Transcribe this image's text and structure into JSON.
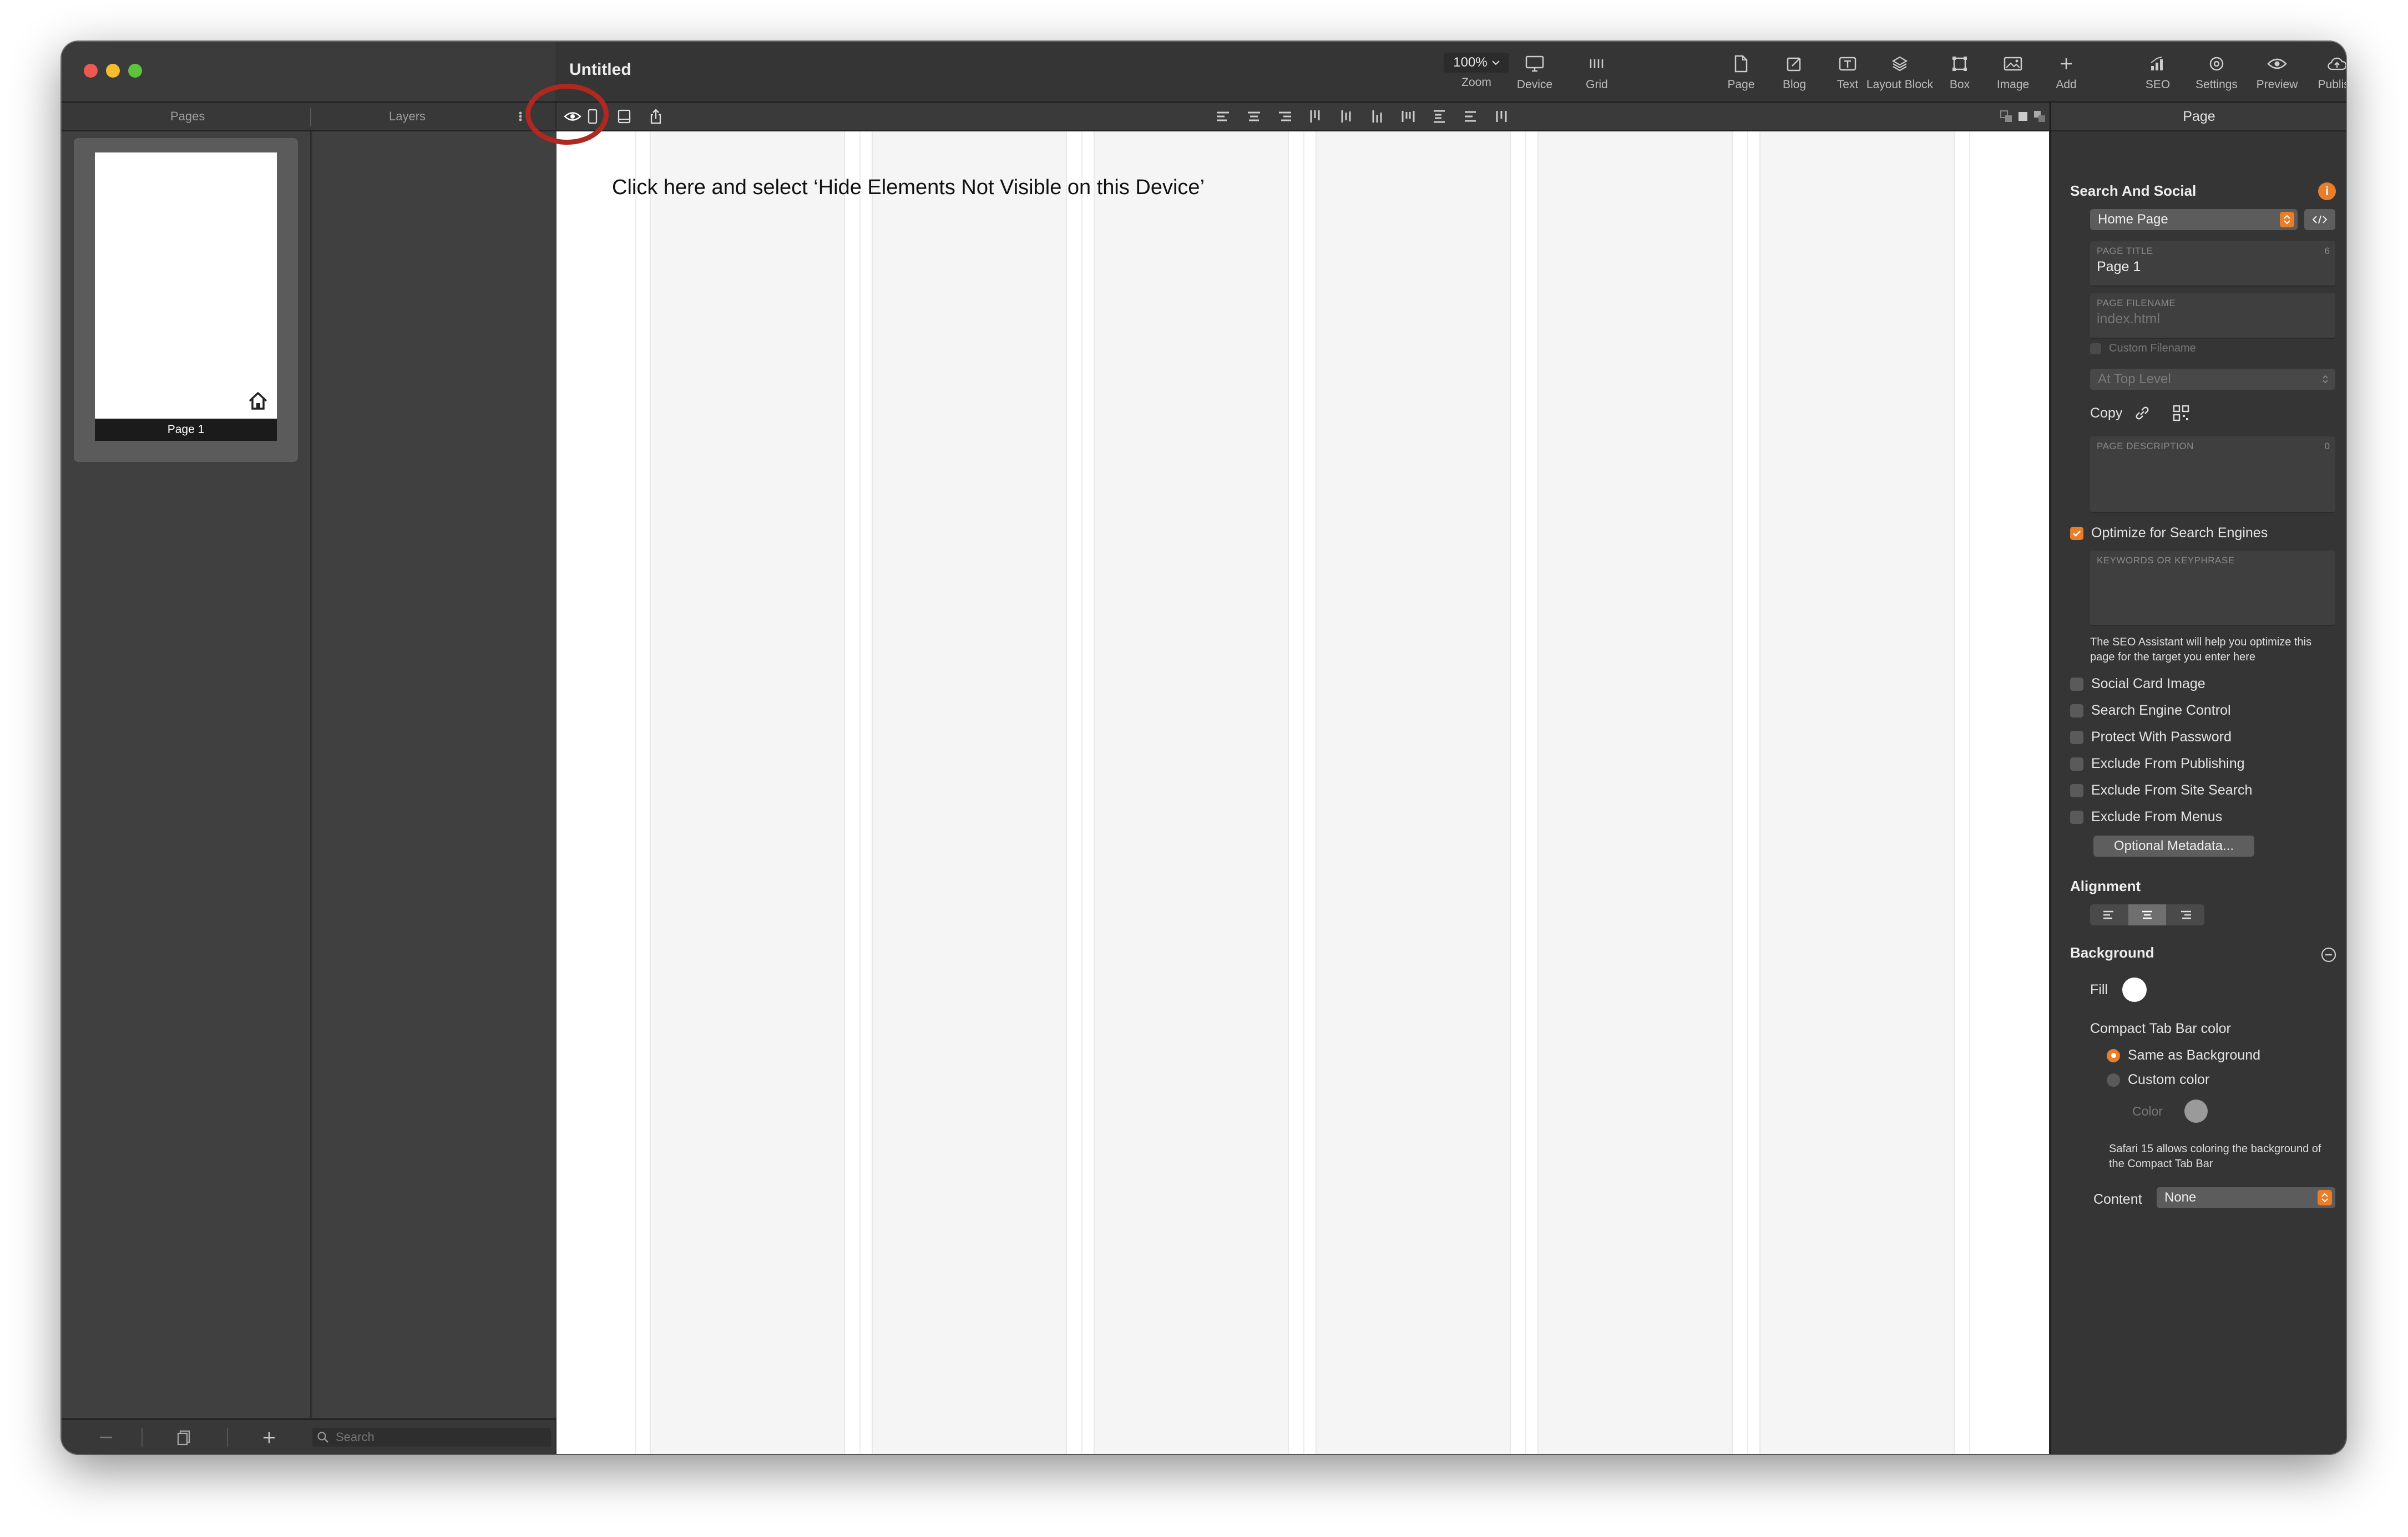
{
  "window": {
    "title": "Untitled"
  },
  "toolbar": {
    "zoom_value": "100%",
    "items": [
      {
        "label": "Zoom",
        "icon": "zoom-popup"
      },
      {
        "label": "Device",
        "icon": "monitor-icon"
      },
      {
        "label": "Grid",
        "icon": "grid-icon"
      },
      {
        "label": "Page",
        "icon": "page-icon"
      },
      {
        "label": "Blog",
        "icon": "blog-icon"
      },
      {
        "label": "Text",
        "icon": "text-icon"
      },
      {
        "label": "Layout Block",
        "icon": "layers-icon"
      },
      {
        "label": "Box",
        "icon": "box-icon"
      },
      {
        "label": "Image",
        "icon": "image-icon"
      },
      {
        "label": "Add",
        "icon": "plus-icon"
      },
      {
        "label": "SEO",
        "icon": "seo-chart-icon"
      },
      {
        "label": "Settings",
        "icon": "settings-icon"
      },
      {
        "label": "Preview",
        "icon": "eye-icon"
      },
      {
        "label": "Publish",
        "icon": "cloud-upload-icon"
      }
    ]
  },
  "sidebar": {
    "tabs": {
      "pages": "Pages",
      "layers": "Layers"
    },
    "pages": [
      {
        "label": "Page 1",
        "is_home": true
      }
    ],
    "search_placeholder": "Search"
  },
  "canvas": {
    "instruction": "Click here and select ‘Hide Elements Not Visible on this Device’"
  },
  "inspector": {
    "header": "Page",
    "search_social": {
      "title": "Search And Social",
      "page_type": "Home Page",
      "page_title_label": "PAGE TITLE",
      "page_title_count": "6",
      "page_title_value": "Page 1",
      "filename_label": "PAGE FILENAME",
      "filename_value": "index.html",
      "custom_filename_label": "Custom Filename",
      "level_value": "At Top Level",
      "copy_label": "Copy",
      "description_label": "PAGE DESCRIPTION",
      "description_count": "0",
      "optimize_label": "Optimize for Search Engines",
      "keywords_label": "KEYWORDS OR KEYPHRASE",
      "seo_note": "The SEO Assistant will help you optimize this page for the target you enter here",
      "options": [
        "Social Card Image",
        "Search Engine Control",
        "Protect With Password",
        "Exclude From Publishing",
        "Exclude From Site Search",
        "Exclude From Menus"
      ],
      "metadata_button": "Optional Metadata..."
    },
    "alignment": {
      "title": "Alignment",
      "selected": "center"
    },
    "background": {
      "title": "Background",
      "fill_label": "Fill",
      "fill_color": "#ffffff",
      "tabbar_label": "Compact Tab Bar color",
      "radio_same": "Same as Background",
      "radio_custom": "Custom color",
      "color_label": "Color",
      "custom_color": "#9a9a9a",
      "safari_note": "Safari 15 allows coloring the background of the Compact Tab Bar",
      "content_label": "Content",
      "content_value": "None"
    }
  },
  "colors": {
    "accent": "#e87e2a",
    "highlight_ring": "#b0281f"
  }
}
